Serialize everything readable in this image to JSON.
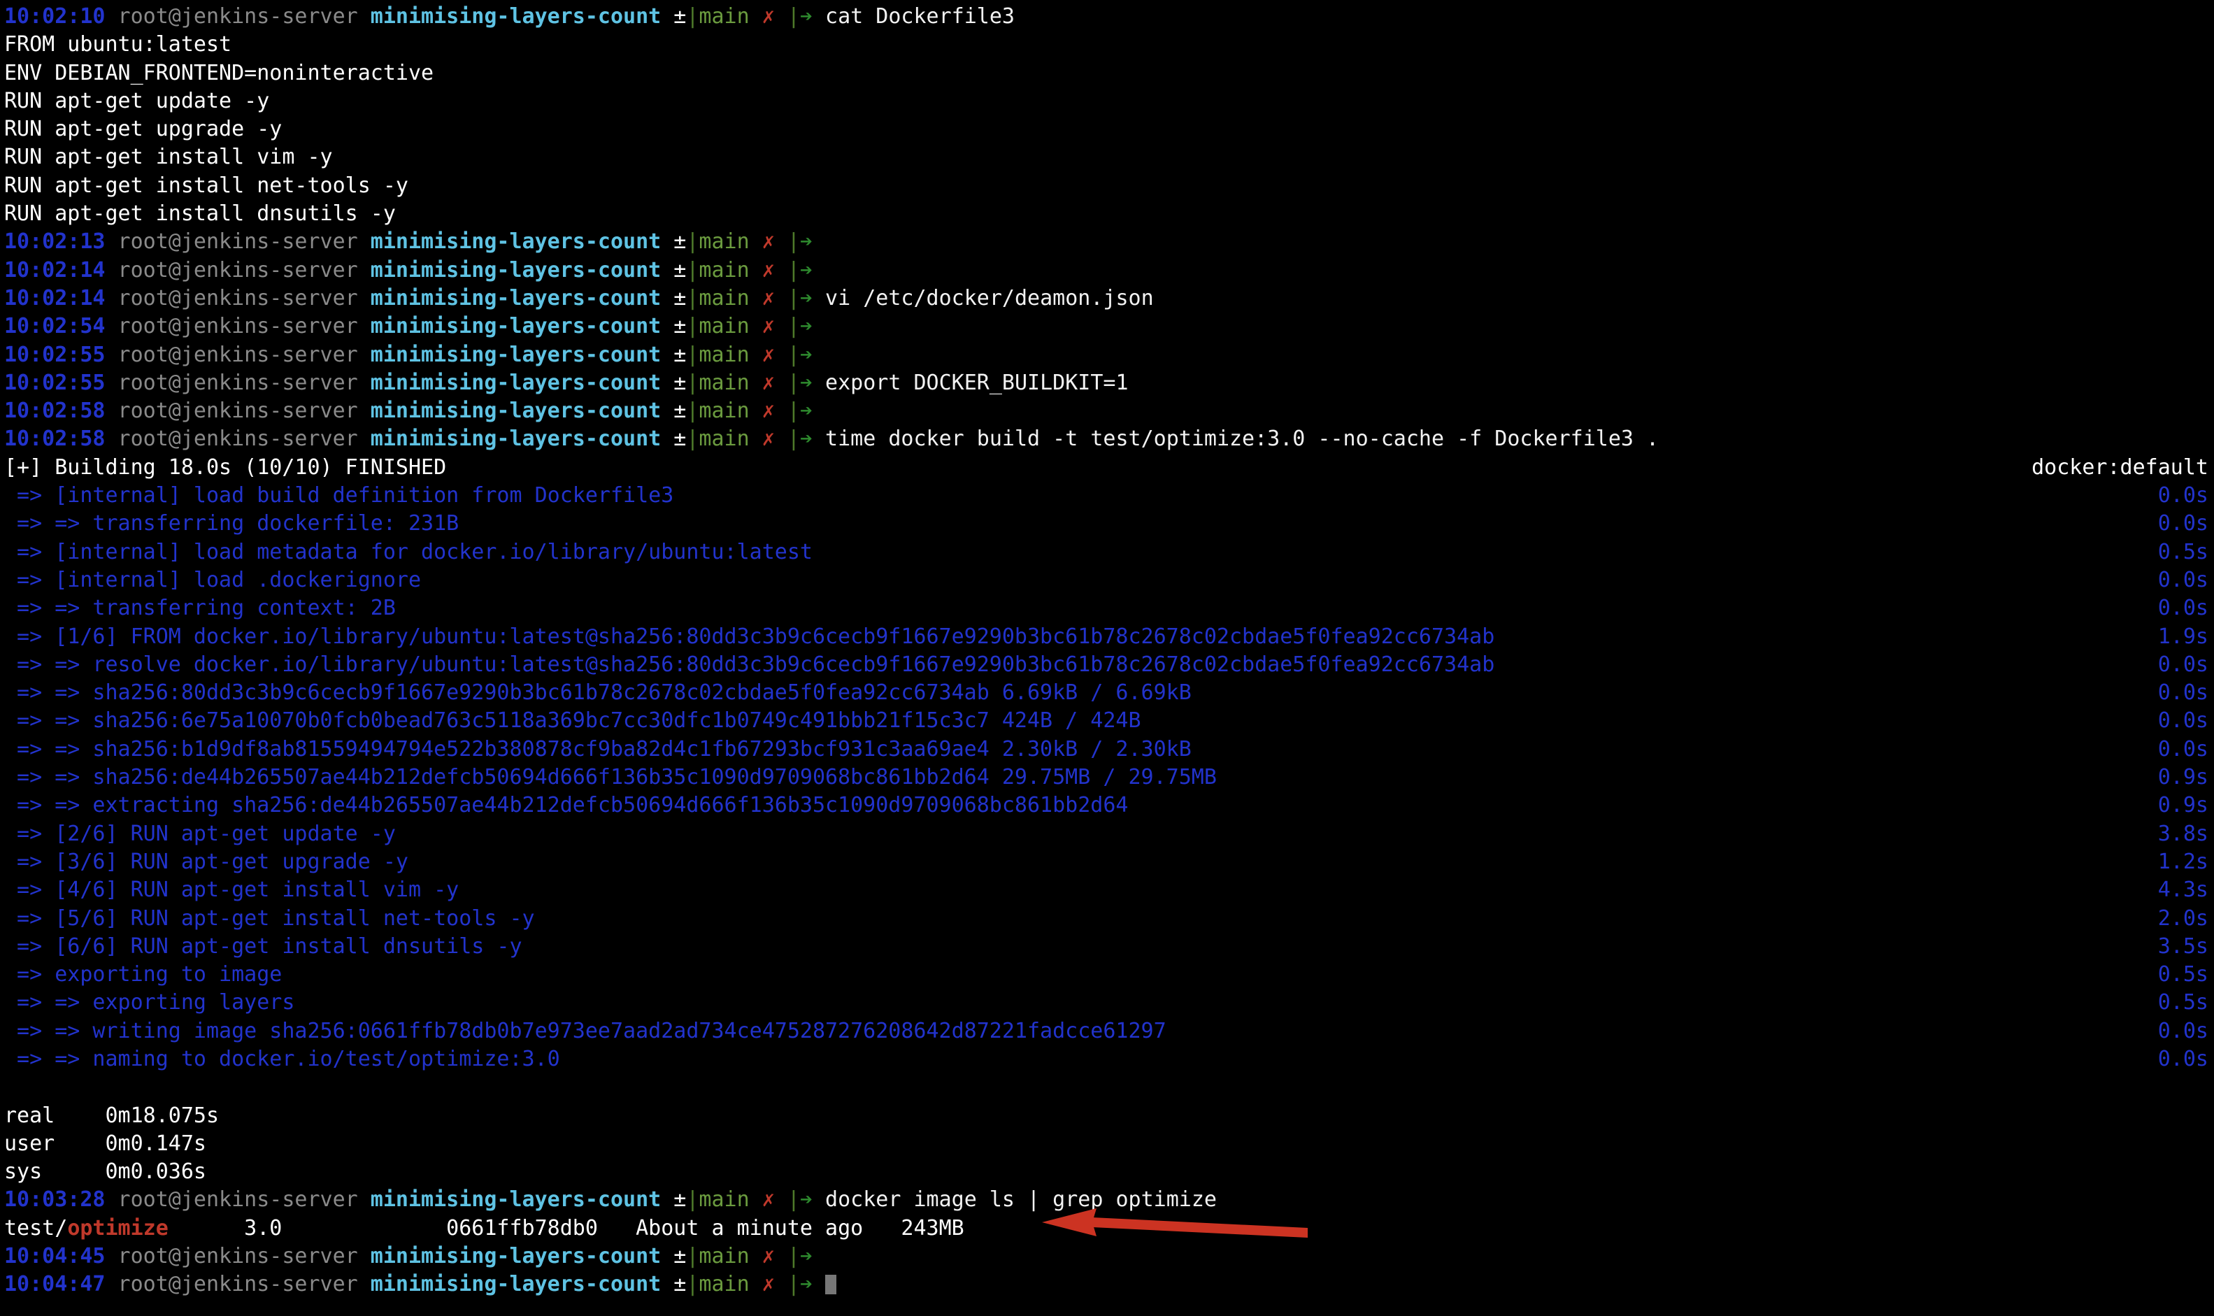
{
  "terminal": {
    "prompt": {
      "user_host": "root@jenkins-server",
      "directory": "minimising-layers-count",
      "plusminus": "±",
      "pipe": "|",
      "branch": "main",
      "dirty_mark": "✗",
      "arrow": "➔"
    },
    "lines": [
      {
        "type": "prompt",
        "time": "10:02:10",
        "command": "cat Dockerfile3"
      },
      {
        "type": "output",
        "text": "FROM ubuntu:latest"
      },
      {
        "type": "output",
        "text": "ENV DEBIAN_FRONTEND=noninteractive"
      },
      {
        "type": "output",
        "text": "RUN apt-get update -y"
      },
      {
        "type": "output",
        "text": "RUN apt-get upgrade -y"
      },
      {
        "type": "output",
        "text": "RUN apt-get install vim -y"
      },
      {
        "type": "output",
        "text": "RUN apt-get install net-tools -y"
      },
      {
        "type": "output",
        "text": "RUN apt-get install dnsutils -y"
      },
      {
        "type": "prompt",
        "time": "10:02:13",
        "command": ""
      },
      {
        "type": "prompt",
        "time": "10:02:14",
        "command": ""
      },
      {
        "type": "prompt",
        "time": "10:02:14",
        "command": "vi /etc/docker/deamon.json"
      },
      {
        "type": "prompt",
        "time": "10:02:54",
        "command": ""
      },
      {
        "type": "prompt",
        "time": "10:02:55",
        "command": ""
      },
      {
        "type": "prompt",
        "time": "10:02:55",
        "command": "export DOCKER_BUILDKIT=1"
      },
      {
        "type": "prompt",
        "time": "10:02:58",
        "command": ""
      },
      {
        "type": "prompt",
        "time": "10:02:58",
        "command": "time docker build -t test/optimize:3.0 --no-cache -f Dockerfile3 ."
      },
      {
        "type": "build-header",
        "text": "[+] Building 18.0s (10/10) FINISHED",
        "right": "docker:default"
      },
      {
        "type": "build",
        "text": " => [internal] load build definition from Dockerfile3",
        "right": "0.0s"
      },
      {
        "type": "build",
        "text": " => => transferring dockerfile: 231B",
        "right": "0.0s"
      },
      {
        "type": "build",
        "text": " => [internal] load metadata for docker.io/library/ubuntu:latest",
        "right": "0.5s"
      },
      {
        "type": "build",
        "text": " => [internal] load .dockerignore",
        "right": "0.0s"
      },
      {
        "type": "build",
        "text": " => => transferring context: 2B",
        "right": "0.0s"
      },
      {
        "type": "build",
        "text": " => [1/6] FROM docker.io/library/ubuntu:latest@sha256:80dd3c3b9c6cecb9f1667e9290b3bc61b78c2678c02cbdae5f0fea92cc6734ab",
        "right": "1.9s"
      },
      {
        "type": "build",
        "text": " => => resolve docker.io/library/ubuntu:latest@sha256:80dd3c3b9c6cecb9f1667e9290b3bc61b78c2678c02cbdae5f0fea92cc6734ab",
        "right": "0.0s"
      },
      {
        "type": "build",
        "text": " => => sha256:80dd3c3b9c6cecb9f1667e9290b3bc61b78c2678c02cbdae5f0fea92cc6734ab 6.69kB / 6.69kB",
        "right": "0.0s"
      },
      {
        "type": "build",
        "text": " => => sha256:6e75a10070b0fcb0bead763c5118a369bc7cc30dfc1b0749c491bbb21f15c3c7 424B / 424B",
        "right": "0.0s"
      },
      {
        "type": "build",
        "text": " => => sha256:b1d9df8ab81559494794e522b380878cf9ba82d4c1fb67293bcf931c3aa69ae4 2.30kB / 2.30kB",
        "right": "0.0s"
      },
      {
        "type": "build",
        "text": " => => sha256:de44b265507ae44b212defcb50694d666f136b35c1090d9709068bc861bb2d64 29.75MB / 29.75MB",
        "right": "0.9s"
      },
      {
        "type": "build",
        "text": " => => extracting sha256:de44b265507ae44b212defcb50694d666f136b35c1090d9709068bc861bb2d64",
        "right": "0.9s"
      },
      {
        "type": "build",
        "text": " => [2/6] RUN apt-get update -y",
        "right": "3.8s"
      },
      {
        "type": "build",
        "text": " => [3/6] RUN apt-get upgrade -y",
        "right": "1.2s"
      },
      {
        "type": "build",
        "text": " => [4/6] RUN apt-get install vim -y",
        "right": "4.3s"
      },
      {
        "type": "build",
        "text": " => [5/6] RUN apt-get install net-tools -y",
        "right": "2.0s"
      },
      {
        "type": "build",
        "text": " => [6/6] RUN apt-get install dnsutils -y",
        "right": "3.5s"
      },
      {
        "type": "build",
        "text": " => exporting to image",
        "right": "0.5s"
      },
      {
        "type": "build",
        "text": " => => exporting layers",
        "right": "0.5s"
      },
      {
        "type": "build",
        "text": " => => writing image sha256:0661ffb78db0b7e973ee7aad2ad734ce475287276208642d87221fadcce61297",
        "right": "0.0s"
      },
      {
        "type": "build",
        "text": " => => naming to docker.io/test/optimize:3.0",
        "right": "0.0s"
      },
      {
        "type": "blank"
      },
      {
        "type": "output",
        "text": "real    0m18.075s"
      },
      {
        "type": "output",
        "text": "user    0m0.147s"
      },
      {
        "type": "output",
        "text": "sys     0m0.036s"
      },
      {
        "type": "prompt",
        "time": "10:03:28",
        "command": "docker image ls | grep optimize"
      },
      {
        "type": "grep-row",
        "repo_prefix": "test/",
        "repo_match": "optimize",
        "tag": "3.0",
        "image_id": "0661ffb78db0",
        "created": "About a minute ago",
        "size": "243MB"
      },
      {
        "type": "prompt",
        "time": "10:04:45",
        "command": ""
      },
      {
        "type": "prompt",
        "time": "10:04:47",
        "command": "",
        "cursor": true
      }
    ]
  },
  "annotation": {
    "arrow_color": "#cc3322",
    "points_to": "243MB"
  }
}
